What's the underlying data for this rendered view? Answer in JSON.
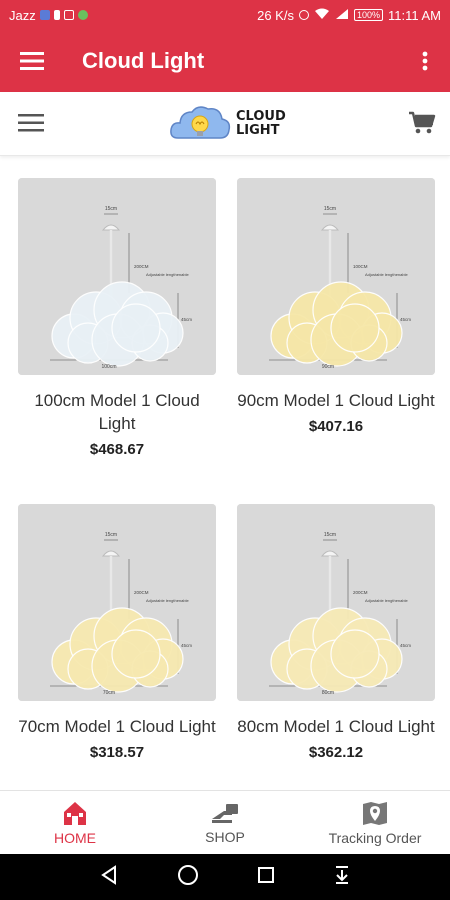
{
  "status_bar": {
    "carrier": "Jazz",
    "net_speed": "26 K/s",
    "battery": "100%",
    "time": "11:11 AM"
  },
  "app_bar": {
    "title": "Cloud Light",
    "menu_icon": "hamburger-icon",
    "overflow_icon": "kebab-icon"
  },
  "store_header": {
    "logo_line1": "CLOUD",
    "logo_line2": "LIGHT",
    "menu_icon": "hamburger-icon",
    "cart_icon": "cart-icon"
  },
  "products": [
    {
      "name": "100cm Model 1 Cloud Light",
      "price": "$468.67",
      "glow": "#e9f1f6",
      "image_labels": [
        "15cm",
        "200CM",
        "Adjustable lengthenable",
        "45cm",
        "100cm"
      ]
    },
    {
      "name": "90cm Model 1 Cloud Light",
      "price": "$407.16",
      "glow": "#f6e7a8",
      "image_labels": [
        "15cm",
        "100CM",
        "Adjustable lengthenable",
        "45cm",
        "90cm"
      ]
    },
    {
      "name": "70cm Model 1 Cloud Light",
      "price": "$318.57",
      "glow": "#f7e9b0",
      "image_labels": [
        "15cm",
        "200CM",
        "Adjustable lengthenable",
        "45cm",
        "70cm"
      ]
    },
    {
      "name": "80cm Model 1 Cloud Light",
      "price": "$362.12",
      "glow": "#f7eab6",
      "image_labels": [
        "15cm",
        "200CM",
        "Adjustable lengthenable",
        "45cm",
        "80cm"
      ]
    }
  ],
  "bottom_nav": [
    {
      "label": "HOME",
      "icon": "home-icon",
      "active": true
    },
    {
      "label": "SHOP",
      "icon": "shop-icon",
      "active": false
    },
    {
      "label": "Tracking Order",
      "icon": "map-pin-icon",
      "active": false
    }
  ],
  "system_nav": {
    "back_icon": "back-triangle-icon",
    "home_icon": "circle-home-icon",
    "recents_icon": "square-recents-icon",
    "extra_icon": "download-arrow-icon"
  },
  "colors": {
    "accent": "#dd3346",
    "image_bg": "#d9d9d9",
    "text_dark": "#222222"
  }
}
